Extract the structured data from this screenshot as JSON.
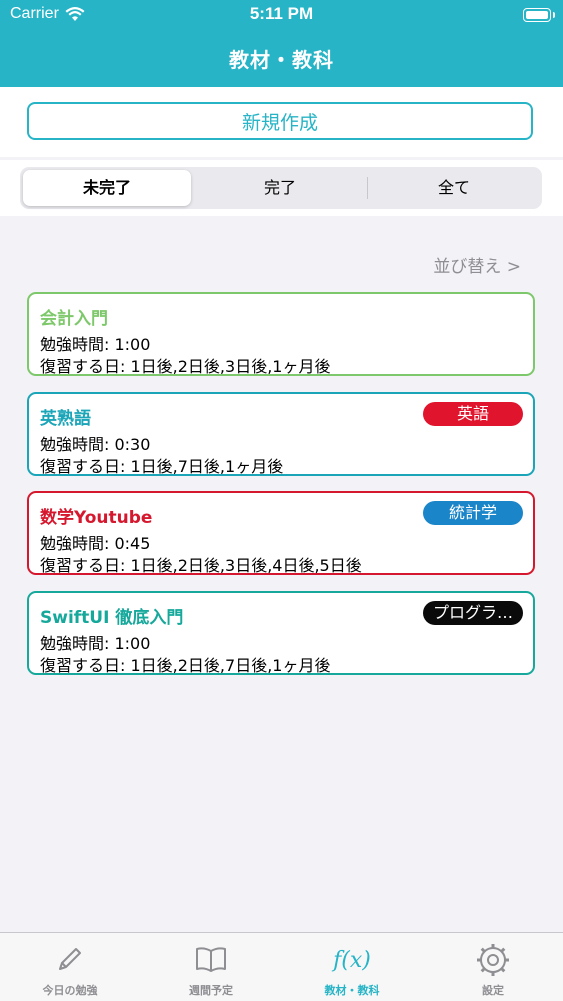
{
  "status_bar": {
    "carrier": "Carrier",
    "time": "5:11 PM"
  },
  "nav": {
    "title": "教材・教科"
  },
  "new_button": {
    "label": "新規作成"
  },
  "segments": [
    {
      "label": "未完了",
      "selected": true
    },
    {
      "label": "完了",
      "selected": false
    },
    {
      "label": "全て",
      "selected": false
    }
  ],
  "sort": {
    "label": "並び替え >"
  },
  "materials": [
    {
      "title": "会計入門",
      "study_time": "勉強時間: 1:00",
      "review_days": "復習する日: 1日後,2日後,3日後,1ヶ月後",
      "color": "#7dc86a",
      "tag": null
    },
    {
      "title": "英熟語",
      "study_time": "勉強時間: 0:30",
      "review_days": "復習する日: 1日後,7日後,1ヶ月後",
      "color": "#1aa5b8",
      "tag": {
        "label": "英語",
        "color": "#e0142c"
      }
    },
    {
      "title": "数学Youtube",
      "study_time": "勉強時間: 0:45",
      "review_days": "復習する日: 1日後,2日後,3日後,4日後,5日後",
      "color": "#d6182e",
      "tag": {
        "label": "統計学",
        "color": "#1a85c8"
      }
    },
    {
      "title": "SwiftUI 徹底入門",
      "study_time": "勉強時間: 1:00",
      "review_days": "復習する日: 1日後,2日後,7日後,1ヶ月後",
      "color": "#16a89b",
      "tag": {
        "label": "プログラ…",
        "color": "#0a0a0a"
      }
    }
  ],
  "tabs": [
    {
      "label": "今日の勉強",
      "icon": "pencil-icon",
      "active": false
    },
    {
      "label": "週間予定",
      "icon": "book-icon",
      "active": false
    },
    {
      "label": "教材・教科",
      "icon": "function-icon",
      "active": true
    },
    {
      "label": "設定",
      "icon": "gear-icon",
      "active": false
    }
  ],
  "colors": {
    "accent": "#27b4c6",
    "inactive": "#8e8e93",
    "background": "#f2f2f7"
  }
}
